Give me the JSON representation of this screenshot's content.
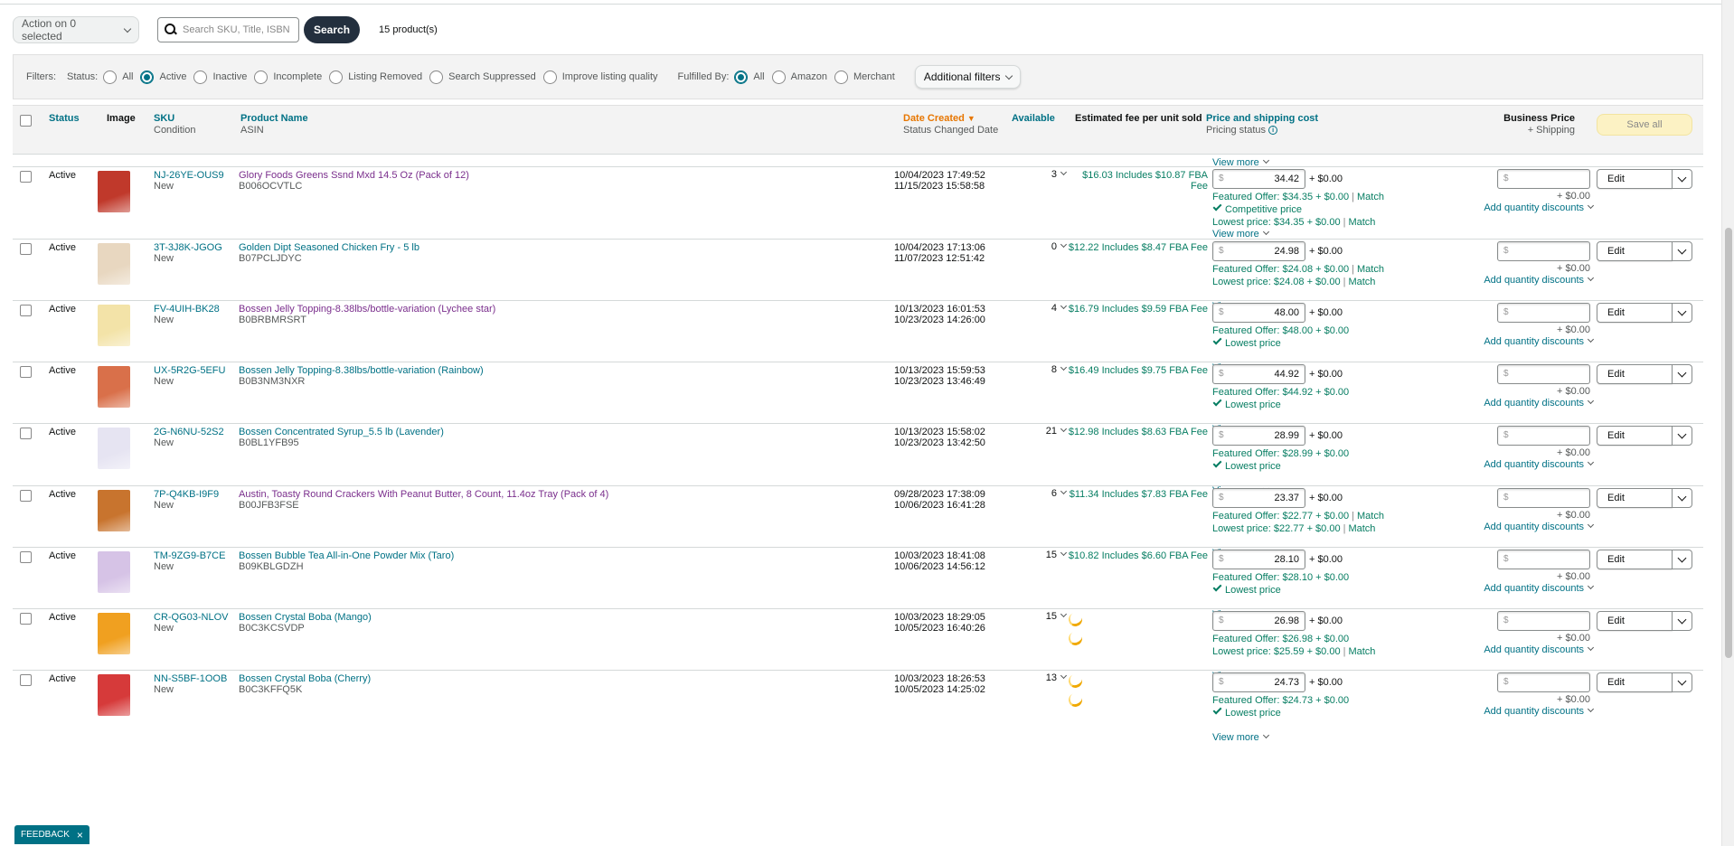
{
  "toolbar": {
    "action_label": "Action on 0 selected",
    "search_placeholder": "Search SKU, Title, ISBN",
    "search_button": "Search",
    "product_count": "15 product(s)"
  },
  "filters": {
    "label": "Filters:",
    "status_label": "Status:",
    "status_options": [
      "All",
      "Active",
      "Inactive",
      "Incomplete",
      "Listing Removed",
      "Search Suppressed",
      "Improve listing quality"
    ],
    "status_selected": "Active",
    "fulfilled_label": "Fulfilled By:",
    "fulfilled_options": [
      "All",
      "Amazon",
      "Merchant"
    ],
    "fulfilled_selected": "All",
    "additional_filters": "Additional filters"
  },
  "columns": {
    "status": "Status",
    "image": "Image",
    "sku": "SKU",
    "condition": "Condition",
    "product_name": "Product Name",
    "asin": "ASIN",
    "date_created": "Date Created",
    "status_changed": "Status Changed Date",
    "available": "Available",
    "est_fee": "Estimated fee per unit sold",
    "price_shipping": "Price and shipping cost",
    "pricing_status": "Pricing status",
    "business_price": "Business Price",
    "plus_shipping": "+ Shipping",
    "save_all": "Save all"
  },
  "common": {
    "view_more": "View more",
    "plus_shipping": "+ $0.00",
    "add_qty": "Add quantity discounts",
    "edit": "Edit",
    "match": "Match",
    "dollar": "$"
  },
  "products": [
    {
      "status": "Active",
      "sku": "NJ-26YE-OUS9",
      "condition": "New",
      "name": "Glory Foods Greens Ssnd Mxd 14.5 Oz (Pack of 12)",
      "visited": true,
      "asin": "B006OCVTLC",
      "created": "10/04/2023 17:49:52",
      "changed": "11/15/2023 15:58:58",
      "available": "3",
      "fee": "$16.03 Includes $10.87 FBA Fee",
      "price": "34.42",
      "featured": "Featured Offer: $34.35 + $0.00",
      "featured_match": true,
      "tick": "Competitive price",
      "lowest": "Lowest price: $34.35 + $0.00",
      "lowest_match": true,
      "thumb": "#c0392b"
    },
    {
      "status": "Active",
      "sku": "3T-3J8K-JGOG",
      "condition": "New",
      "name": "Golden Dipt Seasoned Chicken Fry - 5 lb",
      "visited": false,
      "asin": "B07PCLJDYC",
      "created": "10/04/2023 17:13:06",
      "changed": "11/07/2023 12:51:42",
      "available": "0",
      "fee": "$12.22 Includes $8.47 FBA Fee",
      "price": "24.98",
      "featured": "Featured Offer: $24.08 + $0.00",
      "featured_match": true,
      "tick": "",
      "lowest": "Lowest price: $24.08 + $0.00",
      "lowest_match": true,
      "thumb": "#e8d7c0"
    },
    {
      "status": "Active",
      "sku": "FV-4UIH-BK28",
      "condition": "New",
      "name": "Bossen Jelly Topping-8.38lbs/bottle-variation (Lychee star)",
      "visited": true,
      "asin": "B0BRBMRSRT",
      "created": "10/13/2023 16:01:53",
      "changed": "10/23/2023 14:26:00",
      "available": "4",
      "fee": "$16.79 Includes $9.59 FBA Fee",
      "price": "48.00",
      "featured": "Featured Offer: $48.00 + $0.00",
      "featured_match": false,
      "tick": "Lowest price",
      "lowest": "",
      "lowest_match": false,
      "thumb": "#f3e3a8"
    },
    {
      "status": "Active",
      "sku": "UX-5R2G-5EFU",
      "condition": "New",
      "name": "Bossen Jelly Topping-8.38lbs/bottle-variation (Rainbow)",
      "visited": false,
      "asin": "B0B3NM3NXR",
      "created": "10/13/2023 15:59:53",
      "changed": "10/23/2023 13:46:49",
      "available": "8",
      "fee": "$16.49 Includes $9.75 FBA Fee",
      "price": "44.92",
      "featured": "Featured Offer: $44.92 + $0.00",
      "featured_match": false,
      "tick": "Lowest price",
      "lowest": "",
      "lowest_match": false,
      "thumb": "#d9704a"
    },
    {
      "status": "Active",
      "sku": "2G-N6NU-52S2",
      "condition": "New",
      "name": "Bossen Concentrated Syrup_5.5 lb (Lavender)",
      "visited": false,
      "asin": "B0BL1YFB95",
      "created": "10/13/2023 15:58:02",
      "changed": "10/23/2023 13:42:50",
      "available": "21",
      "fee": "$12.98 Includes $8.63 FBA Fee",
      "price": "28.99",
      "featured": "Featured Offer: $28.99 + $0.00",
      "featured_match": false,
      "tick": "Lowest price",
      "lowest": "",
      "lowest_match": false,
      "thumb": "#e6e4f2"
    },
    {
      "status": "Active",
      "sku": "7P-Q4KB-I9F9",
      "condition": "New",
      "name": "Austin, Toasty Round Crackers With Peanut Butter, 8 Count, 11.4oz Tray (Pack of 4)",
      "visited": true,
      "asin": "B00JFB3FSE",
      "created": "09/28/2023 17:38:09",
      "changed": "10/06/2023 16:41:28",
      "available": "6",
      "fee": "$11.34 Includes $7.83 FBA Fee",
      "price": "23.37",
      "featured": "Featured Offer: $22.77 + $0.00",
      "featured_match": true,
      "tick": "",
      "lowest": "Lowest price: $22.77 + $0.00",
      "lowest_match": true,
      "thumb": "#c8742e"
    },
    {
      "status": "Active",
      "sku": "TM-9ZG9-B7CE",
      "condition": "New",
      "name": "Bossen Bubble Tea All-in-One Powder Mix (Taro)",
      "visited": false,
      "asin": "B09KBLGDZH",
      "created": "10/03/2023 18:41:08",
      "changed": "10/06/2023 14:56:12",
      "available": "15",
      "fee": "$10.82 Includes $6.60 FBA Fee",
      "price": "28.10",
      "featured": "Featured Offer: $28.10 + $0.00",
      "featured_match": false,
      "tick": "Lowest price",
      "lowest": "",
      "lowest_match": false,
      "thumb": "#d6c3e6"
    },
    {
      "status": "Active",
      "sku": "CR-QG03-NLOV",
      "condition": "New",
      "name": "Bossen Crystal Boba (Mango)",
      "visited": false,
      "asin": "B0C3KCSVDP",
      "created": "10/03/2023 18:29:05",
      "changed": "10/05/2023 16:40:26",
      "available": "15",
      "fee": "",
      "price": "26.98",
      "featured": "Featured Offer: $26.98 + $0.00",
      "featured_match": false,
      "tick": "",
      "lowest": "Lowest price: $25.59 + $0.00",
      "lowest_match": true,
      "thumb": "#f0a020"
    },
    {
      "status": "Active",
      "sku": "NN-S5BF-1OOB",
      "condition": "New",
      "name": "Bossen Crystal Boba (Cherry)",
      "visited": false,
      "asin": "B0C3KFFQ5K",
      "created": "10/03/2023 18:26:53",
      "changed": "10/05/2023 14:25:02",
      "available": "13",
      "fee": "",
      "price": "24.73",
      "featured": "Featured Offer: $24.73 + $0.00",
      "featured_match": false,
      "tick": "Lowest price",
      "lowest": "",
      "lowest_match": false,
      "thumb": "#d63a3a"
    }
  ],
  "feedback": "FEEDBACK"
}
